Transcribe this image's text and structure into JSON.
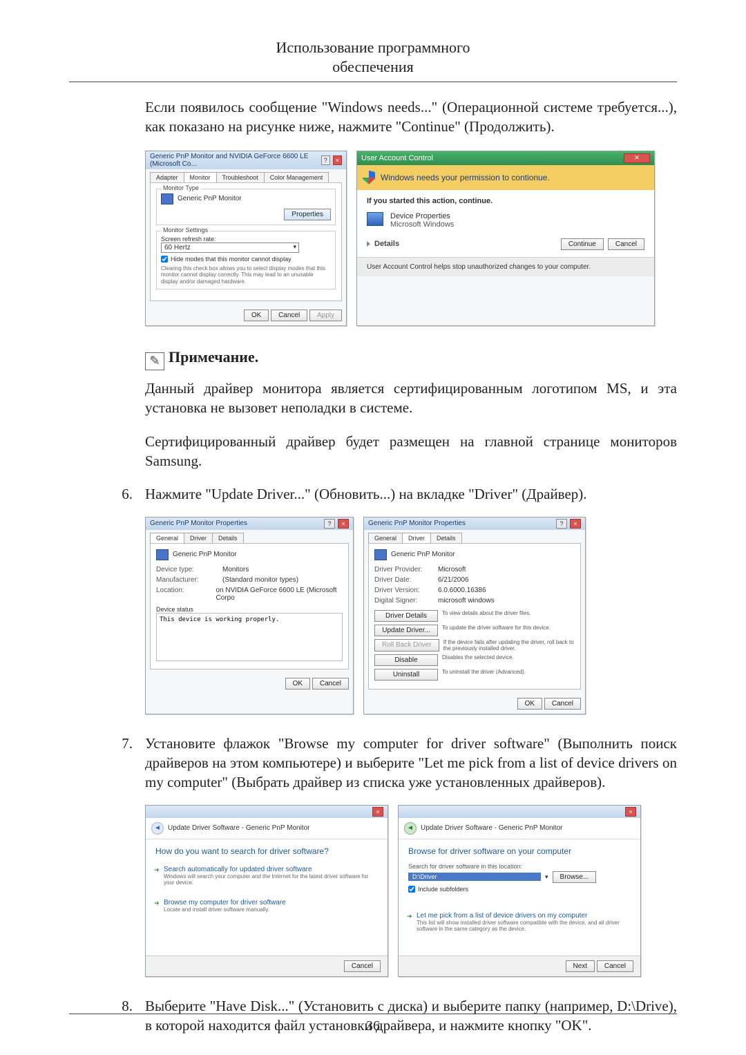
{
  "header": {
    "line1": "Использование программного",
    "line2": "обеспечения"
  },
  "intro": "Если появилось сообщение \"Windows needs...\" (Операционной системе требуется...), как показано на рисунке ниже, нажмите \"Continue\" (Продолжить).",
  "monitorDlg": {
    "title": "Generic PnP Monitor and NVIDIA GeForce 6600 LE (Microsoft Co...",
    "tabs": {
      "t0": "Adapter",
      "t1": "Monitor",
      "t2": "Troubleshoot",
      "t3": "Color Management"
    },
    "monitorType": "Monitor Type",
    "monitorName": "Generic PnP Monitor",
    "propertiesBtn": "Properties",
    "settingsLegend": "Monitor Settings",
    "refreshLabel": "Screen refresh rate:",
    "refreshValue": "60 Hertz",
    "hideModes": "Hide modes that this monitor cannot display",
    "hideModesDesc": "Clearing this check box allows you to select display modes that this monitor cannot display correctly. This may lead to an unusable display and/or damaged hardware.",
    "ok": "OK",
    "cancel": "Cancel",
    "apply": "Apply"
  },
  "uac": {
    "title": "User Account Control",
    "headline": "Windows needs your permission to contionue.",
    "ifStarted": "If you started this action, continue.",
    "dp1": "Device Properties",
    "dp2": "Microsoft Windows",
    "details": "Details",
    "continue": "Continue",
    "cancel": "Cancel",
    "footer": "User Account Control helps stop unauthorized changes to your computer."
  },
  "note": {
    "label": "Примечание."
  },
  "noteText1": "Данный драйвер монитора является сертифицированным логотипом MS, и эта установка не вызовет неполадки в системе.",
  "noteText2": "Сертифицированный драйвер будет размещен на главной странице мониторов Samsung.",
  "step6": {
    "n": "6.",
    "text": "Нажмите \"Update Driver...\" (Обновить...) на вкладке \"Driver\" (Драйвер)."
  },
  "propsGeneral": {
    "title": "Generic PnP Monitor Properties",
    "tabs": {
      "t0": "General",
      "t1": "Driver",
      "t2": "Details"
    },
    "monitorName": "Generic PnP Monitor",
    "devTypeLab": "Device type:",
    "devTypeVal": "Monitors",
    "mfgLab": "Manufacturer:",
    "mfgVal": "(Standard monitor types)",
    "locLab": "Location:",
    "locVal": "on NVIDIA GeForce 6600 LE (Microsoft Corpo",
    "statusLegend": "Device status",
    "statusText": "This device is working properly.",
    "ok": "OK",
    "cancel": "Cancel"
  },
  "propsDriver": {
    "title": "Generic PnP Monitor Properties",
    "tabs": {
      "t0": "General",
      "t1": "Driver",
      "t2": "Details"
    },
    "monitorName": "Generic PnP Monitor",
    "provLab": "Driver Provider:",
    "provVal": "Microsoft",
    "dateLab": "Driver Date:",
    "dateVal": "6/21/2006",
    "verLab": "Driver Version:",
    "verVal": "6.0.6000.16386",
    "signLab": "Digital Signer:",
    "signVal": "microsoft windows",
    "bDetails": "Driver Details",
    "bDetailsDesc": "To view details about the driver files.",
    "bUpdate": "Update Driver...",
    "bUpdateDesc": "To update the driver software for this device.",
    "bRoll": "Roll Back Driver",
    "bRollDesc": "If the device fails after updating the driver, roll back to the previously installed driver.",
    "bDisable": "Disable",
    "bDisableDesc": "Disables the selected device.",
    "bUninstall": "Uninstall",
    "bUninstallDesc": "To uninstall the driver (Advanced).",
    "ok": "OK",
    "cancel": "Cancel"
  },
  "step7": {
    "n": "7.",
    "text": "Установите флажок \"Browse my computer for driver software\" (Выполнить поиск драйверов на этом компьютере) и выберите \"Let me pick from a list of device drivers on my computer\" (Выбрать драйвер из списка уже установленных драйверов)."
  },
  "wizA": {
    "crumb": "Update Driver Software - Generic PnP Monitor",
    "heading": "How do you want to search for driver software?",
    "opt1t": "Search automatically for updated driver software",
    "opt1d": "Windows will search your computer and the Internet for the latest driver software for your device.",
    "opt2t": "Browse my computer for driver software",
    "opt2d": "Locate and install driver software manually.",
    "cancel": "Cancel"
  },
  "wizB": {
    "crumb": "Update Driver Software - Generic PnP Monitor",
    "heading": "Browse for driver software on your computer",
    "searchLab": "Search for driver software in this location:",
    "path": "D:\\Driver",
    "browse": "Browse...",
    "include": "Include subfolders",
    "opt1t": "Let me pick from a list of device drivers on my computer",
    "opt1d": "This list will show installed driver software compatible with the device, and all driver software in the same category as the device.",
    "next": "Next",
    "cancel": "Cancel"
  },
  "step8": {
    "n": "8.",
    "text": "Выберите \"Have Disk...\" (Установить с диска) и выберите папку (например, D:\\Drive), в которой находится файл установки драйвера, и нажмите кнопку \"OK\"."
  },
  "pageNumber": "36"
}
